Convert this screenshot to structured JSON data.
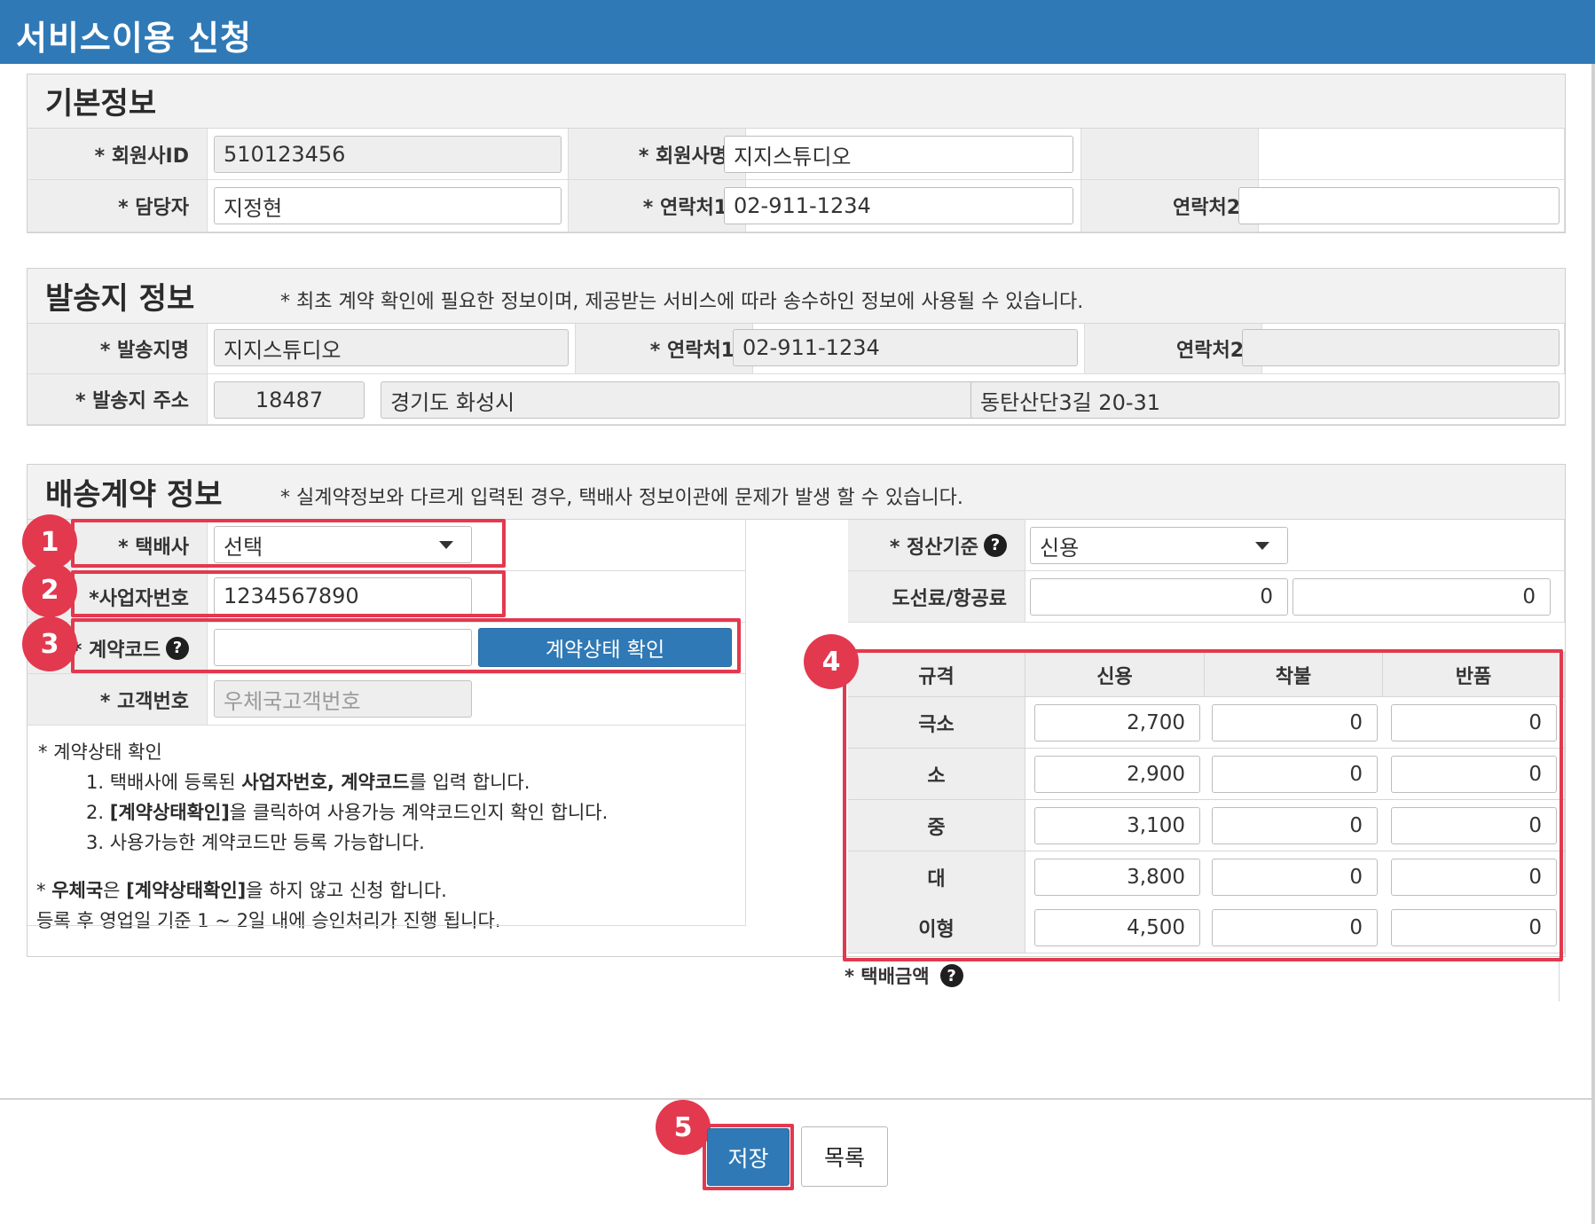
{
  "page": {
    "title": "서비스이용 신청"
  },
  "basic": {
    "title": "기본정보",
    "member_id_label": "* 회원사ID",
    "member_id_value": "510123456",
    "member_name_label": "* 회원사명",
    "member_name_value": "지지스튜디오",
    "manager_label": "* 담당자",
    "manager_value": "지정현",
    "contact1_label": "* 연락처1",
    "contact1_value": "02-911-1234",
    "contact2_label": "연락처2",
    "contact2_value": ""
  },
  "sender": {
    "title": "발송지 정보",
    "note": "* 최초 계약 확인에 필요한 정보이며, 제공받는 서비스에 따라 송수하인 정보에 사용될 수 있습니다.",
    "name_label": "* 발송지명",
    "name_value": "지지스튜디오",
    "contact1_label": "* 연락처1",
    "contact1_value": "02-911-1234",
    "contact2_label": "연락처2",
    "contact2_value": "",
    "address_label": "* 발송지 주소",
    "zipcode": "18487",
    "address1": "경기도 화성시",
    "address2": "동탄산단3길 20-31"
  },
  "contract": {
    "title": "배송계약 정보",
    "note": "* 실계약정보와 다르게 입력된 경우, 택배사 정보이관에 문제가 발생 할 수 있습니다.",
    "courier_label": "* 택배사",
    "courier_value": "선택",
    "biz_no_label": "*사업자번호",
    "biz_no_value": "1234567890",
    "contract_code_label": "* 계약코드",
    "contract_code_value": "",
    "check_button": "계약상태 확인",
    "customer_no_label": "* 고객번호",
    "customer_no_placeholder": "우체국고객번호",
    "settlement_label": "* 정산기준",
    "settlement_value": "신용",
    "island_fee_label": "도선료/항공료",
    "island_fee_1": "0",
    "island_fee_2": "0",
    "help_icon": "question-circle-icon",
    "instructions": {
      "heading": "* 계약상태 확인",
      "step1_a": "1. 택배사에 등록된 ",
      "step1_b": "사업자번호, 계약코드",
      "step1_c": "를 입력 합니다.",
      "step2_a": "2. ",
      "step2_b": "[계약상태확인]",
      "step2_c": "을 클릭하여 사용가능 계약코드인지 확인 합니다.",
      "step3": "3. 사용가능한 계약코드만 등록 가능합니다.",
      "post_a": "* ",
      "post_b": "우체국",
      "post_c": "은 ",
      "post_d": "[계약상태확인]",
      "post_e": "을 하지 않고 신청 합니다.",
      "post_line2": "등록 후 영업일 기준 1 ~ 2일 내에 승인처리가 진행 됩니다."
    },
    "rate_table": {
      "headers": [
        "규격",
        "신용",
        "착불",
        "반품"
      ],
      "rows": [
        {
          "size": "극소",
          "credit": "2,700",
          "cod": "0",
          "return": "0"
        },
        {
          "size": "소",
          "credit": "2,900",
          "cod": "0",
          "return": "0"
        },
        {
          "size": "중",
          "credit": "3,100",
          "cod": "0",
          "return": "0"
        },
        {
          "size": "대",
          "credit": "3,800",
          "cod": "0",
          "return": "0"
        },
        {
          "size": "이형",
          "credit": "4,500",
          "cod": "0",
          "return": "0"
        }
      ]
    },
    "delivery_fee_label": "* 택배금액"
  },
  "annotations": {
    "b1": "1",
    "b2": "2",
    "b3": "3",
    "b4": "4",
    "b5": "5"
  },
  "footer": {
    "save_button": "저장",
    "list_button": "목록"
  },
  "colors": {
    "primary": "#2f79b6",
    "highlight": "#e2394f"
  }
}
